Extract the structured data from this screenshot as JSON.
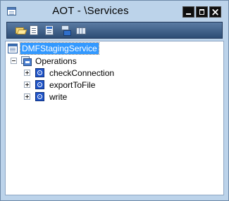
{
  "window": {
    "title": "AOT - \\Services"
  },
  "toolbar": {
    "buttons": [
      {
        "icon": "open-folder-icon"
      },
      {
        "icon": "properties-icon"
      },
      {
        "icon": "properties-list-icon"
      },
      {
        "icon": "compile-icon"
      },
      {
        "icon": "grid-icon"
      }
    ]
  },
  "tree": {
    "root": {
      "label": "DMFStagingService",
      "selected": true,
      "icon": "service-icon"
    },
    "operations": {
      "label": "Operations",
      "expanded": true,
      "icon": "operations-icon"
    },
    "methods": [
      {
        "label": "checkConnection",
        "icon": "method-icon"
      },
      {
        "label": "exportToFile",
        "icon": "method-icon"
      },
      {
        "label": "write",
        "icon": "method-icon"
      }
    ]
  },
  "colors": {
    "selection": "#3399ff",
    "frame": "#bcd3ea",
    "toolbar": "#3d5f8c"
  }
}
